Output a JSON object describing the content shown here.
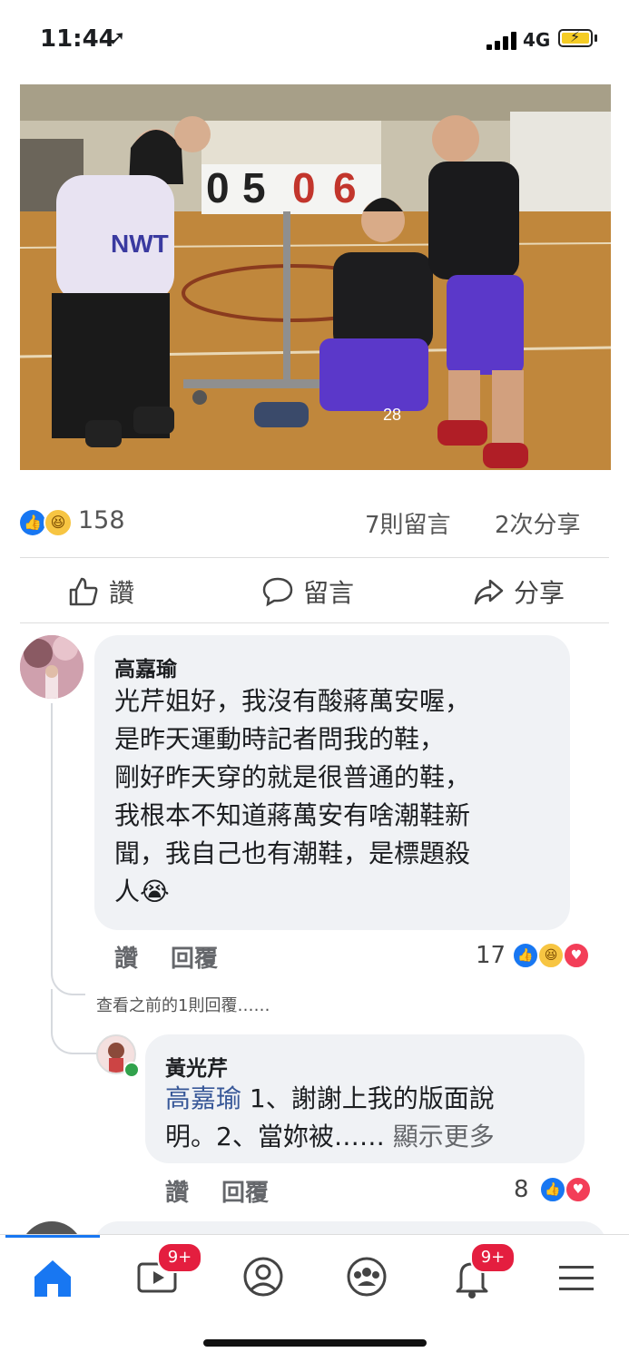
{
  "status_bar": {
    "time": "11:44",
    "network": "4G"
  },
  "post": {
    "reaction_count": "158",
    "comments_count": "7則留言",
    "shares_count": "2次分享",
    "actions": {
      "like": "讚",
      "comment": "留言",
      "share": "分享"
    },
    "scoreboard_digits": [
      "0",
      "5",
      "0",
      "6"
    ],
    "jersey_number": "28"
  },
  "comments": [
    {
      "author": "高嘉瑜",
      "lines": [
        "光芹姐好，我沒有酸蔣萬安喔，",
        "是昨天運動時記者問我的鞋，",
        "剛好昨天穿的就是很普通的鞋，",
        "我根本不知道蔣萬安有啥潮鞋新",
        "聞，我自己也有潮鞋，是標題殺",
        "人😭"
      ],
      "like_label": "讚",
      "reply_label": "回覆",
      "reaction_count": "17"
    }
  ],
  "view_previous": "查看之前的1則回覆……",
  "reply": {
    "author": "黃光芹",
    "mention": "高嘉瑜",
    "line1": " 1、謝謝上我的版面說",
    "line2": "明。2、當妳被……",
    "see_more": " 顯示更多",
    "like_label": "讚",
    "reply_label": "回覆",
    "reaction_count": "8"
  },
  "nav": {
    "watch_badge": "9+",
    "notifications_badge": "9+"
  },
  "colors": {
    "accent": "#1877f2",
    "badge": "#e41e3f",
    "bubble": "#f0f2f5"
  }
}
